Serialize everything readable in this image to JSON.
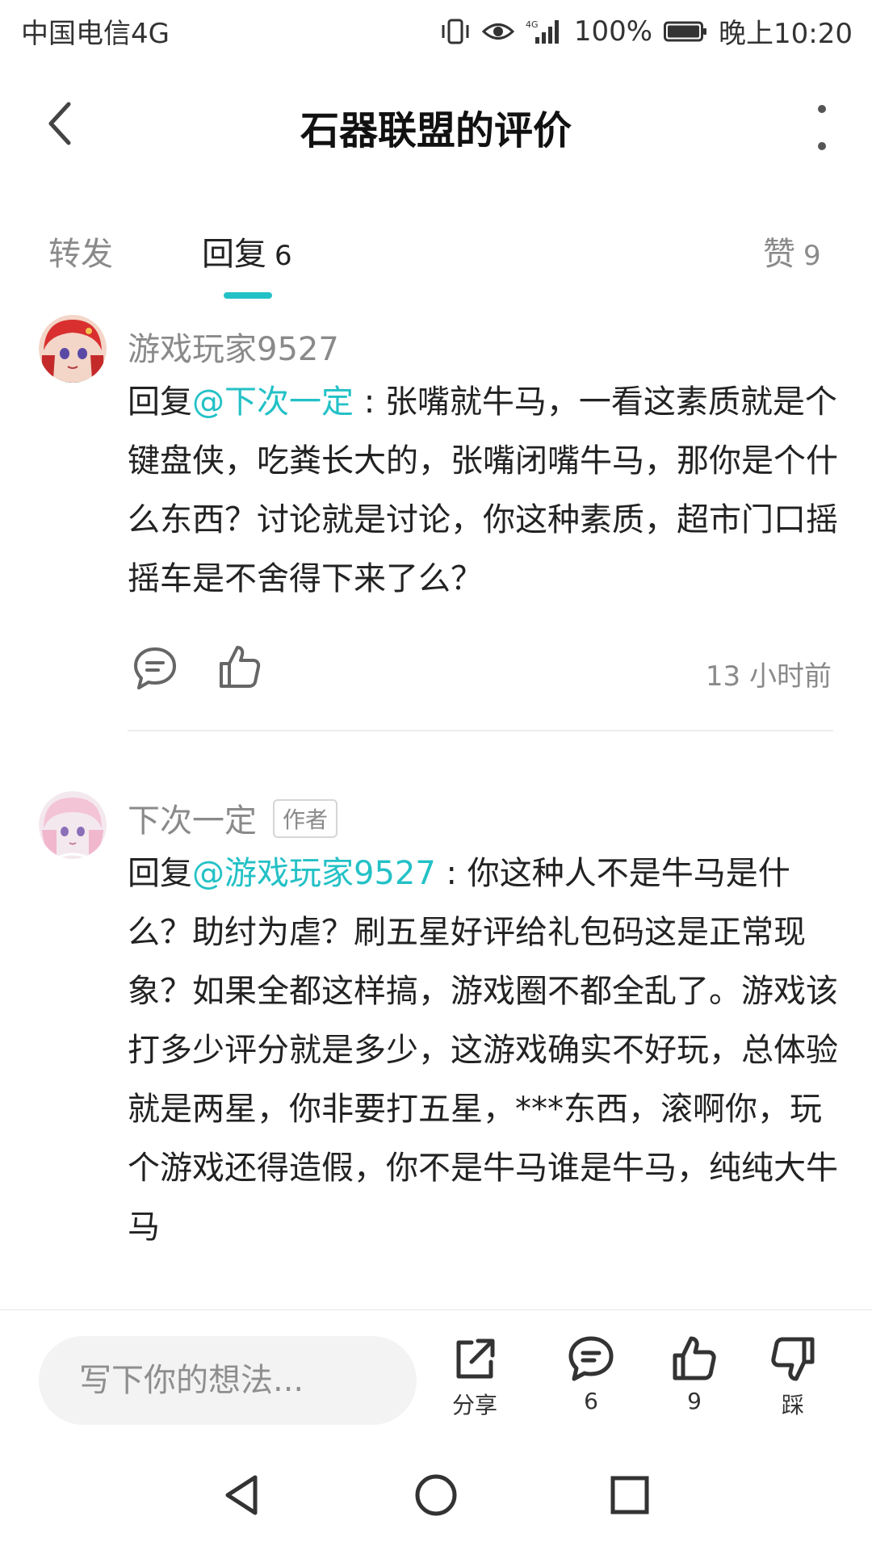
{
  "status_bar": {
    "carrier": "中国电信4G",
    "battery": "100%",
    "time": "晚上10:20"
  },
  "header": {
    "title": "石器联盟的评价"
  },
  "tabs": [
    {
      "label": "转发",
      "count": ""
    },
    {
      "label": "回复",
      "count": "6"
    },
    {
      "label": "赞",
      "count": "9"
    }
  ],
  "comments": [
    {
      "username": "游戏玩家9527",
      "reply_prefix": "回复",
      "mention": "@下次一定",
      "text": " : 张嘴就牛马，一看这素质就是个键盘侠，吃粪长大的，张嘴闭嘴牛马，那你是个什么东西？讨论就是讨论，你这种素质，超市门口摇摇车是不舍得下来了么？",
      "time": "13 小时前"
    },
    {
      "username": "下次一定",
      "badge": "作者",
      "reply_prefix": "回复",
      "mention": "@游戏玩家9527",
      "text": " : 你这种人不是牛马是什么？助纣为虐？刷五星好评给礼包码这是正常现象？如果全都这样搞，游戏圈不都全乱了。游戏该打多少评分就是多少，这游戏确实不好玩，总体验就是两星，你非要打五星，***东西，滚啊你，玩个游戏还得造假，你不是牛马谁是牛马，纯纯大牛马"
    }
  ],
  "bottom_bar": {
    "input_placeholder": "写下你的想法...",
    "share_label": "分享",
    "comment_count": "6",
    "like_count": "9",
    "dislike_label": "踩"
  },
  "colors": {
    "accent": "#23c1c6",
    "text_primary": "#222222",
    "text_secondary": "#8a8a8a"
  }
}
